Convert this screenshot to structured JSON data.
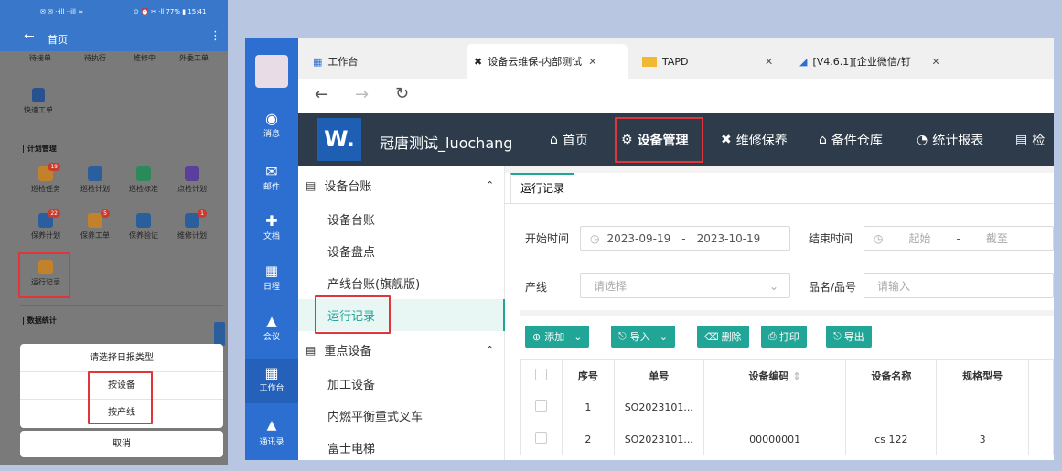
{
  "phone": {
    "status_left": "✉ ✉ ··ill ··ill ≈",
    "status_right": "⊙ ⏰ ✂ ·ll 77% ▮ 15:41",
    "nav_title": "首页",
    "row1": [
      "待接单",
      "待执行",
      "维修中",
      "外委工单"
    ],
    "quick": "快速工单",
    "section_plan": "计划管理",
    "plan_row1": [
      {
        "label": "巡检任务",
        "badge": "19"
      },
      {
        "label": "巡检计划",
        "badge": ""
      },
      {
        "label": "巡检标准",
        "badge": ""
      },
      {
        "label": "点检计划",
        "badge": ""
      }
    ],
    "plan_row2": [
      {
        "label": "保养计划",
        "badge": "22"
      },
      {
        "label": "保养工单",
        "badge": "5"
      },
      {
        "label": "保养验证",
        "badge": ""
      },
      {
        "label": "维修计划",
        "badge": "1"
      }
    ],
    "run_record": "运行记录",
    "section_stats": "数据统计",
    "sheet_title": "请选择日报类型",
    "sheet_opt1": "按设备",
    "sheet_opt2": "按产线",
    "sheet_cancel": "取消"
  },
  "sidebar": [
    "消息",
    "邮件",
    "文档",
    "日程",
    "会议",
    "工作台",
    "通讯录"
  ],
  "tabs": [
    "工作台",
    "设备云维保-内部测试",
    "TAPD",
    "[V4.6.1][企业微信/钉"
  ],
  "app": {
    "logo": "W.",
    "name": "冠唐测试_luochang",
    "menu": [
      "首页",
      "设备管理",
      "维修保养",
      "备件仓库",
      "统计报表",
      "检"
    ]
  },
  "leftnav": {
    "group1": "设备台账",
    "items1": [
      "设备台账",
      "设备盘点",
      "产线台账(旗舰版)",
      "运行记录"
    ],
    "group2": "重点设备",
    "items2": [
      "加工设备",
      "内燃平衡重式叉车",
      "富士电梯"
    ]
  },
  "content": {
    "tab": "运行记录",
    "start_label": "开始时间",
    "start_from": "2023-09-19",
    "dash": "-",
    "start_to": "2023-10-19",
    "end_label": "结束时间",
    "end_from_ph": "起始",
    "end_to_ph": "截至",
    "line_label": "产线",
    "line_ph": "请选择",
    "pn_label": "品名/品号",
    "pn_ph": "请输入",
    "buttons": [
      "添加",
      "导入",
      "删除",
      "打印",
      "导出"
    ],
    "columns": [
      "序号",
      "单号",
      "设备编码",
      "设备名称",
      "规格型号"
    ],
    "rows": [
      [
        "1",
        "SO2023101...",
        "",
        "",
        ""
      ],
      [
        "2",
        "SO2023101...",
        "00000001",
        "cs 122",
        "3"
      ]
    ]
  }
}
